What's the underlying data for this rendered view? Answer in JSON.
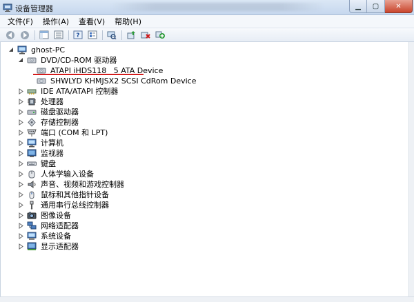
{
  "window": {
    "title": "设备管理器"
  },
  "menu": {
    "items": [
      "文件(F)",
      "操作(A)",
      "查看(V)",
      "帮助(H)"
    ]
  },
  "toolbar": {
    "buttons": [
      "back-icon",
      "forward-icon",
      "show-hide-tree-icon",
      "properties-icon",
      "help-icon",
      "show-hidden-icon",
      "scan-hardware-icon",
      "update-driver-icon",
      "uninstall-icon",
      "enable-device-icon"
    ]
  },
  "tree": {
    "root": "ghost-PC",
    "dvd": {
      "label": "DVD/CD-ROM 驱动器",
      "children": [
        "ATAPI iHDS118   5 ATA Device",
        "SHWLYD KHMJSX2 SCSI CdRom Device"
      ]
    },
    "categories": [
      "IDE ATA/ATAPI 控制器",
      "处理器",
      "磁盘驱动器",
      "存储控制器",
      "端口 (COM 和 LPT)",
      "计算机",
      "监视器",
      "键盘",
      "人体学输入设备",
      "声音、视频和游戏控制器",
      "鼠标和其他指针设备",
      "通用串行总线控制器",
      "图像设备",
      "网络适配器",
      "系统设备",
      "显示适配器"
    ]
  },
  "colors": {
    "annotation_underline": "#d41c1c"
  }
}
